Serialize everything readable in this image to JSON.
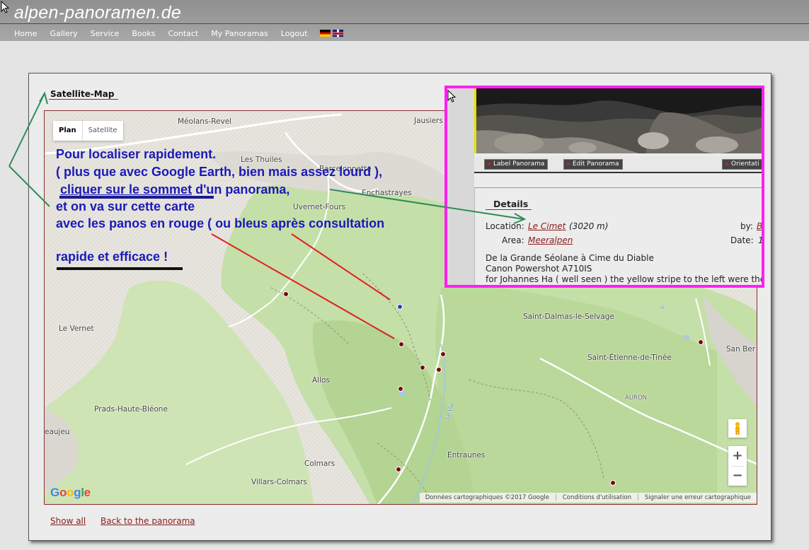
{
  "header": {
    "logo": "alpen-panoramen.de",
    "nav": [
      "Home",
      "Gallery",
      "Service",
      "Books",
      "Contact",
      "My Panoramas",
      "Logout"
    ],
    "flags": [
      "german-flag-icon",
      "english-flag-icon"
    ]
  },
  "panel": {
    "title": "Satellite-Map",
    "footer": {
      "show_all": "Show all",
      "back": "Back to the panorama"
    }
  },
  "map": {
    "type_buttons": {
      "plan": "Plan",
      "satellite": "Satellite"
    },
    "places": {
      "meolans": "Méolans-Revel",
      "jausiers": "Jausiers",
      "thuiles": "Les Thuiles",
      "barcelonnette": "Barcelonnette",
      "enchastrayes": "Enchastrayes",
      "uvernet": "Uvernet-Fours",
      "vernet": "Le Vernet",
      "allos": "Allos",
      "dalmas": "Saint-Dalmas-le-Selvage",
      "etienne": "Saint-Étienne-de-Tinée",
      "auron": "AURON",
      "sanber": "San Ber",
      "prads": "Prads-Haute-Bléone",
      "beaujeu": "eaujeu",
      "entraunes": "Entraunes",
      "colmars": "Colmars",
      "villars": "Villars-Colmars",
      "levar": "Le Var"
    },
    "zoom": {
      "in": "+",
      "out": "−"
    },
    "google": "Google",
    "attribution": [
      "Données cartographiques ©2017 Google",
      "Conditions d'utilisation",
      "Signaler une erreur cartographique"
    ]
  },
  "overlay": {
    "buttons": {
      "label": "Label Panorama",
      "edit": "Edit Panorama",
      "orient": "Orientati"
    },
    "details_title": "Details",
    "location_label": "Location:",
    "location_value": "Le Cimet",
    "location_alt": "(3020 m)",
    "by_label": "by:",
    "by_value": "B",
    "area_label": "Area:",
    "area_value": "Meeralpen",
    "date_label": "Date:",
    "date_value": "1",
    "desc1": "De la Grande Séolane à Cime du Diable",
    "desc2": "Canon Powershot A710IS",
    "desc3": "for Johannes Ha ( well seen ) the yellow stripe to the left were the"
  },
  "annotations": {
    "line1": "Pour localiser rapidement.",
    "line2": "( plus que avec Google Earth, bien mais assez lourd ),",
    "line3a": "cliquer sur le sommet",
    "line3b": " d'un panorama,",
    "line4": "et on va sur cette carte",
    "line5": "avec les panos en rouge ( ou bleus après consultation",
    "line6": "rapide et efficace !"
  }
}
